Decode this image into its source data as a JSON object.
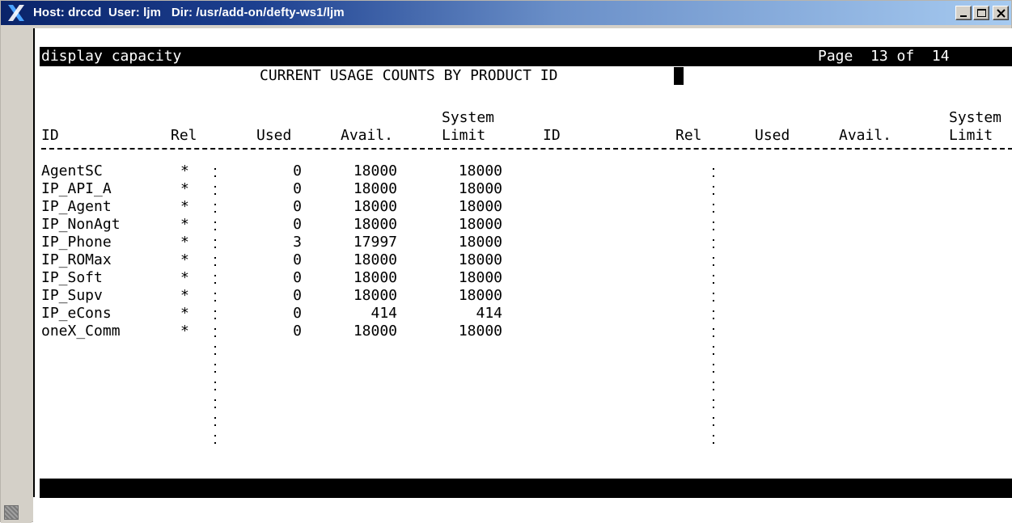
{
  "window": {
    "title": "Host: drccd  User: ljm   Dir: /usr/add-on/defty-ws1/ljm",
    "controls": {
      "minimize": "minimize-icon",
      "maximize": "maximize-icon",
      "close": "close-icon"
    }
  },
  "terminal": {
    "command": "display capacity",
    "page": "Page  13 of  14",
    "report_title": "CURRENT USAGE COUNTS BY PRODUCT ID",
    "headers": {
      "system": "System",
      "id": "ID",
      "rel": "Rel",
      "used": "Used",
      "avail": "Avail.",
      "limit": "Limit"
    },
    "rows": [
      {
        "id": "AgentSC",
        "rel": "*",
        "used": "0",
        "avail": "18000",
        "limit": "18000"
      },
      {
        "id": "IP_API_A",
        "rel": "*",
        "used": "0",
        "avail": "18000",
        "limit": "18000"
      },
      {
        "id": "IP_Agent",
        "rel": "*",
        "used": "0",
        "avail": "18000",
        "limit": "18000"
      },
      {
        "id": "IP_NonAgt",
        "rel": "*",
        "used": "0",
        "avail": "18000",
        "limit": "18000"
      },
      {
        "id": "IP_Phone",
        "rel": "*",
        "used": "3",
        "avail": "17997",
        "limit": "18000"
      },
      {
        "id": "IP_ROMax",
        "rel": "*",
        "used": "0",
        "avail": "18000",
        "limit": "18000"
      },
      {
        "id": "IP_Soft",
        "rel": "*",
        "used": "0",
        "avail": "18000",
        "limit": "18000"
      },
      {
        "id": "IP_Supv",
        "rel": "*",
        "used": "0",
        "avail": "18000",
        "limit": "18000"
      },
      {
        "id": "IP_eCons",
        "rel": "*",
        "used": "0",
        "avail": "414",
        "limit": "414"
      },
      {
        "id": "oneX_Comm",
        "rel": "*",
        "used": "0",
        "avail": "18000",
        "limit": "18000"
      }
    ],
    "separator": ":",
    "empty_rows": 6
  },
  "colors": {
    "title_gradient_start": "#0a246a",
    "title_gradient_end": "#a6caf0",
    "terminal_bg": "#ffffff",
    "terminal_fg": "#000000",
    "frame": "#d4d0c8"
  }
}
